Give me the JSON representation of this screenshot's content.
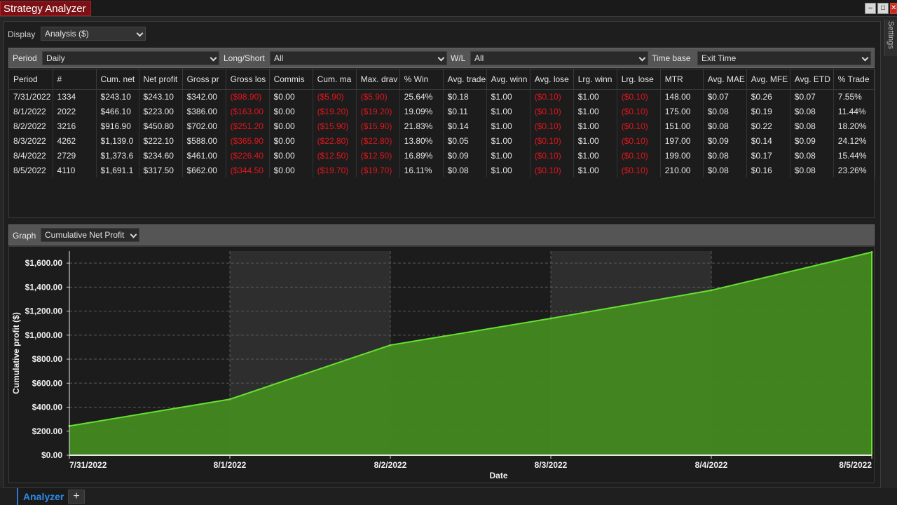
{
  "window": {
    "title": "Strategy Analyzer",
    "min_glyph": "‒",
    "max_glyph": "□",
    "close_glyph": "✕"
  },
  "side_tab": {
    "label": "Settings"
  },
  "display": {
    "label": "Display",
    "value": "Analysis ($)"
  },
  "filters": {
    "period": {
      "label": "Period",
      "value": "Daily"
    },
    "long_short": {
      "label": "Long/Short",
      "value": "All"
    },
    "wl": {
      "label": "W/L",
      "value": "All"
    },
    "time_base": {
      "label": "Time base",
      "value": "Exit Time"
    }
  },
  "table": {
    "headers": [
      "Period",
      "#",
      "Cum. net",
      "Net profit",
      "Gross pr",
      "Gross los",
      "Commis",
      "Cum. ma",
      "Max. drav",
      "% Win",
      "Avg. trade",
      "Avg. winn",
      "Avg. lose",
      "Lrg. winn",
      "Lrg. lose",
      "MTR",
      "Avg. MAE",
      "Avg. MFE",
      "Avg. ETD",
      "% Trade"
    ],
    "negative_cols": [
      5,
      7,
      8,
      12,
      14
    ],
    "rows": [
      [
        "7/31/2022",
        "1334",
        "$243.10",
        "$243.10",
        "$342.00",
        "($98.90)",
        "$0.00",
        "($5.90)",
        "($5.90)",
        "25.64%",
        "$0.18",
        "$1.00",
        "($0.10)",
        "$1.00",
        "($0.10)",
        "148.00",
        "$0.07",
        "$0.26",
        "$0.07",
        "7.55%"
      ],
      [
        "8/1/2022",
        "2022",
        "$466.10",
        "$223.00",
        "$386.00",
        "($163.00",
        "$0.00",
        "($19.20)",
        "($19.20)",
        "19.09%",
        "$0.11",
        "$1.00",
        "($0.10)",
        "$1.00",
        "($0.10)",
        "175.00",
        "$0.08",
        "$0.19",
        "$0.08",
        "11.44%"
      ],
      [
        "8/2/2022",
        "3216",
        "$916.90",
        "$450.80",
        "$702.00",
        "($251.20",
        "$0.00",
        "($15.90)",
        "($15.90)",
        "21.83%",
        "$0.14",
        "$1.00",
        "($0.10)",
        "$1.00",
        "($0.10)",
        "151.00",
        "$0.08",
        "$0.22",
        "$0.08",
        "18.20%"
      ],
      [
        "8/3/2022",
        "4262",
        "$1,139.0",
        "$222.10",
        "$588.00",
        "($365.90",
        "$0.00",
        "($22.80)",
        "($22.80)",
        "13.80%",
        "$0.05",
        "$1.00",
        "($0.10)",
        "$1.00",
        "($0.10)",
        "197.00",
        "$0.09",
        "$0.14",
        "$0.09",
        "24.12%"
      ],
      [
        "8/4/2022",
        "2729",
        "$1,373.6",
        "$234.60",
        "$461.00",
        "($226.40",
        "$0.00",
        "($12.50)",
        "($12.50)",
        "16.89%",
        "$0.09",
        "$1.00",
        "($0.10)",
        "$1.00",
        "($0.10)",
        "199.00",
        "$0.08",
        "$0.17",
        "$0.08",
        "15.44%"
      ],
      [
        "8/5/2022",
        "4110",
        "$1,691.1",
        "$317.50",
        "$662.00",
        "($344.50",
        "$0.00",
        "($19.70)",
        "($19.70)",
        "16.11%",
        "$0.08",
        "$1.00",
        "($0.10)",
        "$1.00",
        "($0.10)",
        "210.00",
        "$0.08",
        "$0.16",
        "$0.08",
        "23.26%"
      ]
    ]
  },
  "graph": {
    "label": "Graph",
    "value": "Cumulative Net Profit"
  },
  "chart_data": {
    "type": "area",
    "x": [
      "7/31/2022",
      "8/1/2022",
      "8/2/2022",
      "8/3/2022",
      "8/4/2022",
      "8/5/2022"
    ],
    "series": [
      {
        "values": [
          243.1,
          466.1,
          916.9,
          1139.0,
          1373.6,
          1691.1
        ]
      }
    ],
    "xlabel": "Date",
    "ylabel": "Cumulative profit ($)",
    "ylim": [
      0,
      1700
    ],
    "yticks": [
      0,
      200,
      400,
      600,
      800,
      1000,
      1200,
      1400,
      1600
    ],
    "ytick_labels": [
      "$0.00",
      "$200.00",
      "$400.00",
      "$600.00",
      "$800.00",
      "$1,000.00",
      "$1,200.00",
      "$1,400.00",
      "$1,600.00"
    ],
    "grid": true,
    "fill_color": "#43891f",
    "line_color": "#66e033"
  },
  "tabs": {
    "active": "Analyzer",
    "add": "+"
  }
}
